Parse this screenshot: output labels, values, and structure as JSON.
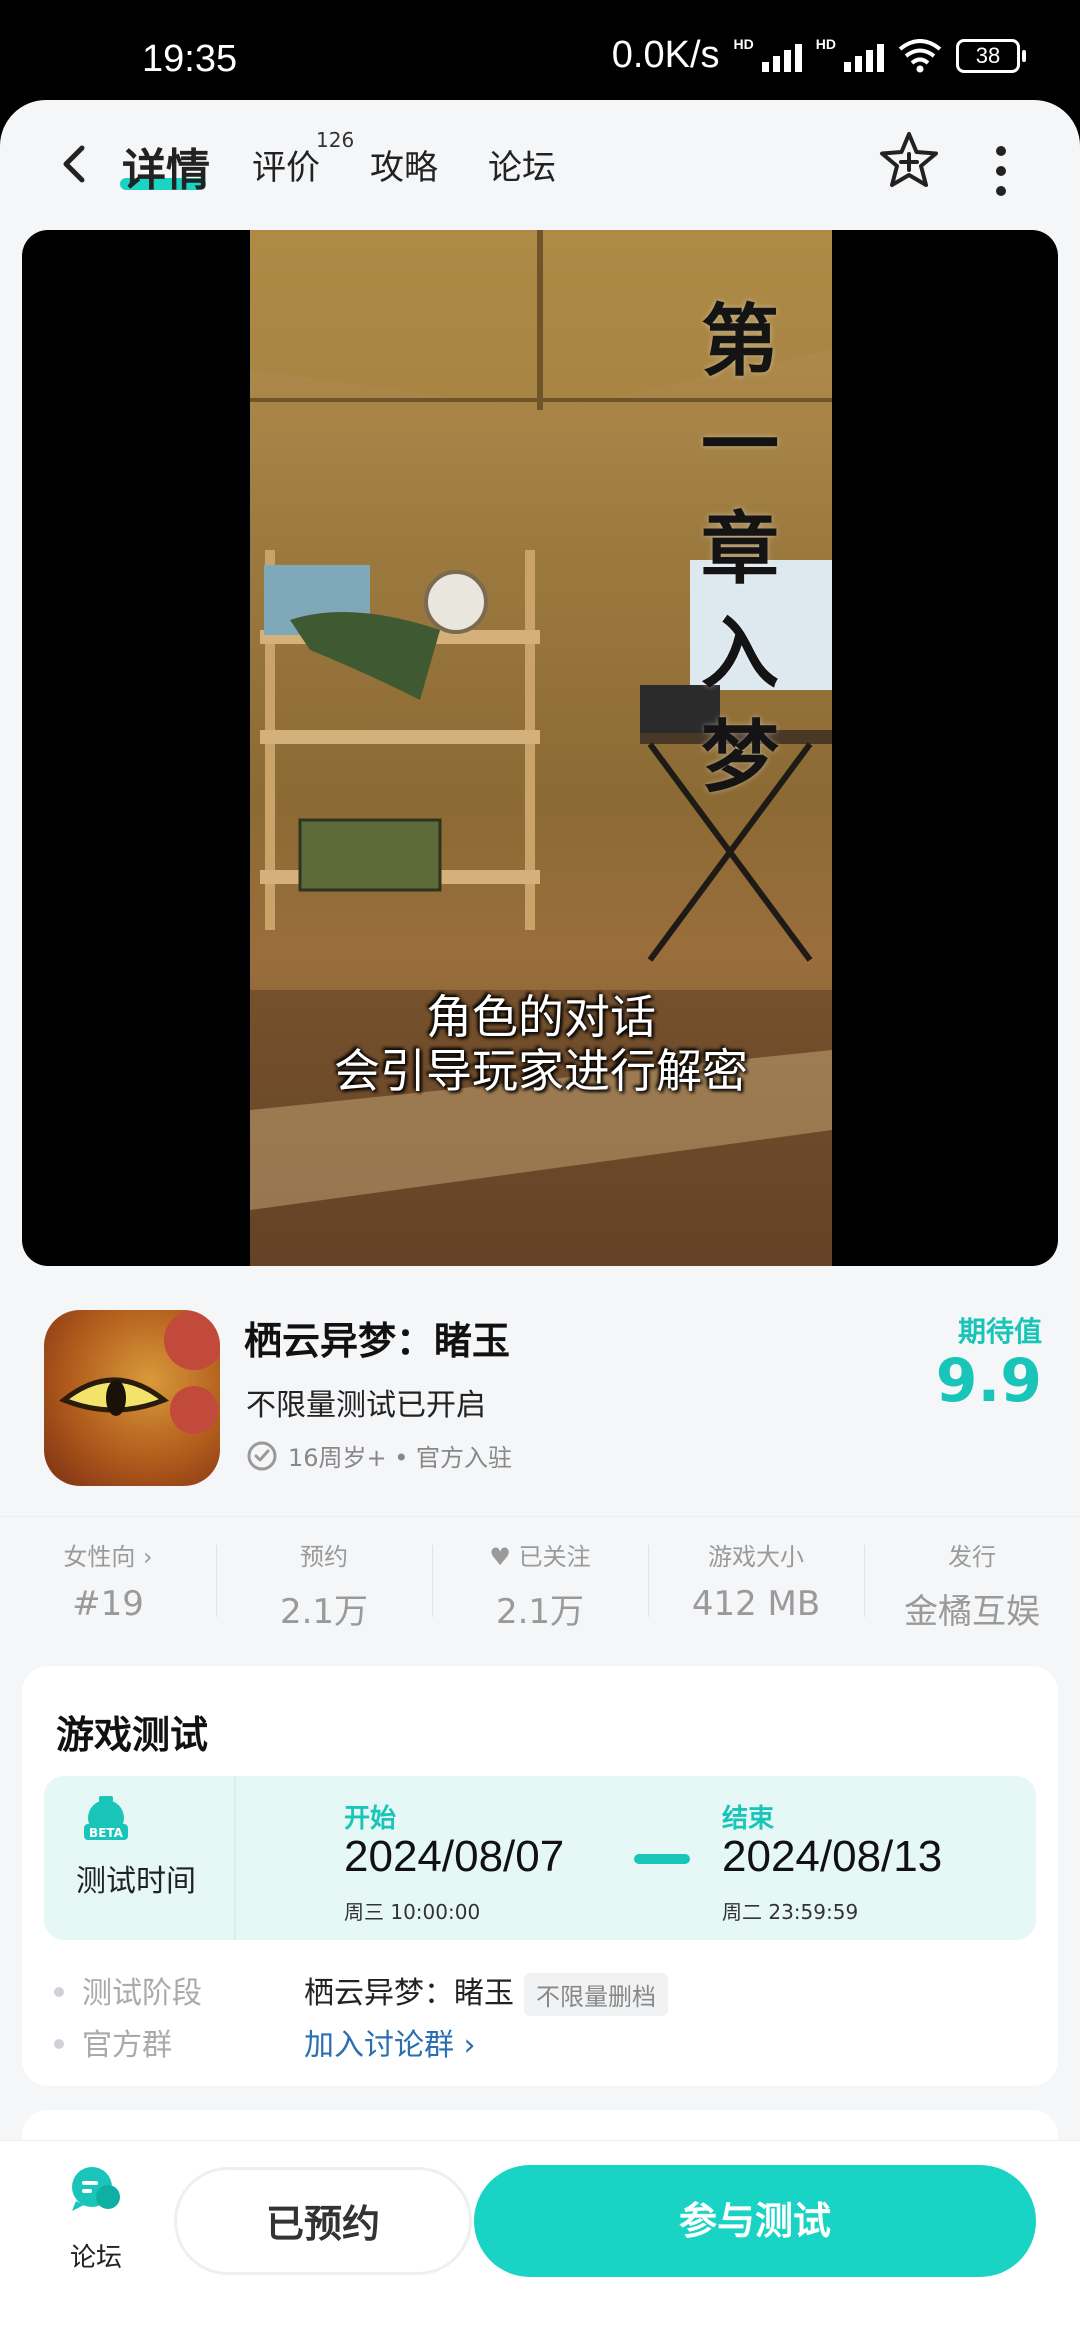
{
  "status_bar": {
    "time": "19:35",
    "speed": "0.0K/s",
    "hd1": "HD",
    "hd2": "HD",
    "battery": "38"
  },
  "nav": {
    "tabs": [
      {
        "label": "详情",
        "active": true
      },
      {
        "label": "评价",
        "badge": "126"
      },
      {
        "label": "攻略"
      },
      {
        "label": "论坛"
      }
    ]
  },
  "media": {
    "chapter_chars": [
      "第",
      "一",
      "章",
      "入",
      "梦"
    ],
    "subtitle_line1": "角色的对话",
    "subtitle_line2": "会引导玩家进行解密"
  },
  "game": {
    "title": "栖云异梦：睹玉",
    "subtitle": "不限量测试已开启",
    "age_info": "16周岁+ • 官方入驻",
    "expectation_label": "期待值",
    "expectation_value": "9.9"
  },
  "stats": [
    {
      "label": "女性向 ›",
      "value": "#19"
    },
    {
      "label": "预约",
      "value": "2.1万"
    },
    {
      "label": "已关注",
      "value": "2.1万"
    },
    {
      "label": "游戏大小",
      "value": "412 MB"
    },
    {
      "label": "发行",
      "value": "金橘互娱"
    }
  ],
  "test": {
    "title": "游戏测试",
    "time_label": "测试时间",
    "beta_text": "BETA",
    "start_label": "开始",
    "start_date": "2024/08/07",
    "start_day": "周三  10:00:00",
    "end_label": "结束",
    "end_date": "2024/08/13",
    "end_day": "周二  23:59:59",
    "stage_label": "测试阶段",
    "stage_value": "栖云异梦：睹玉",
    "stage_tag": "不限量删档",
    "group_label": "官方群",
    "group_link": "加入讨论群 ›"
  },
  "bottom": {
    "forum_label": "论坛",
    "reserved_label": "已预约",
    "join_label": "参与测试"
  },
  "colors": {
    "accent": "#19d3c5",
    "accent_text": "#19c5b8",
    "link": "#2a6fb3"
  }
}
